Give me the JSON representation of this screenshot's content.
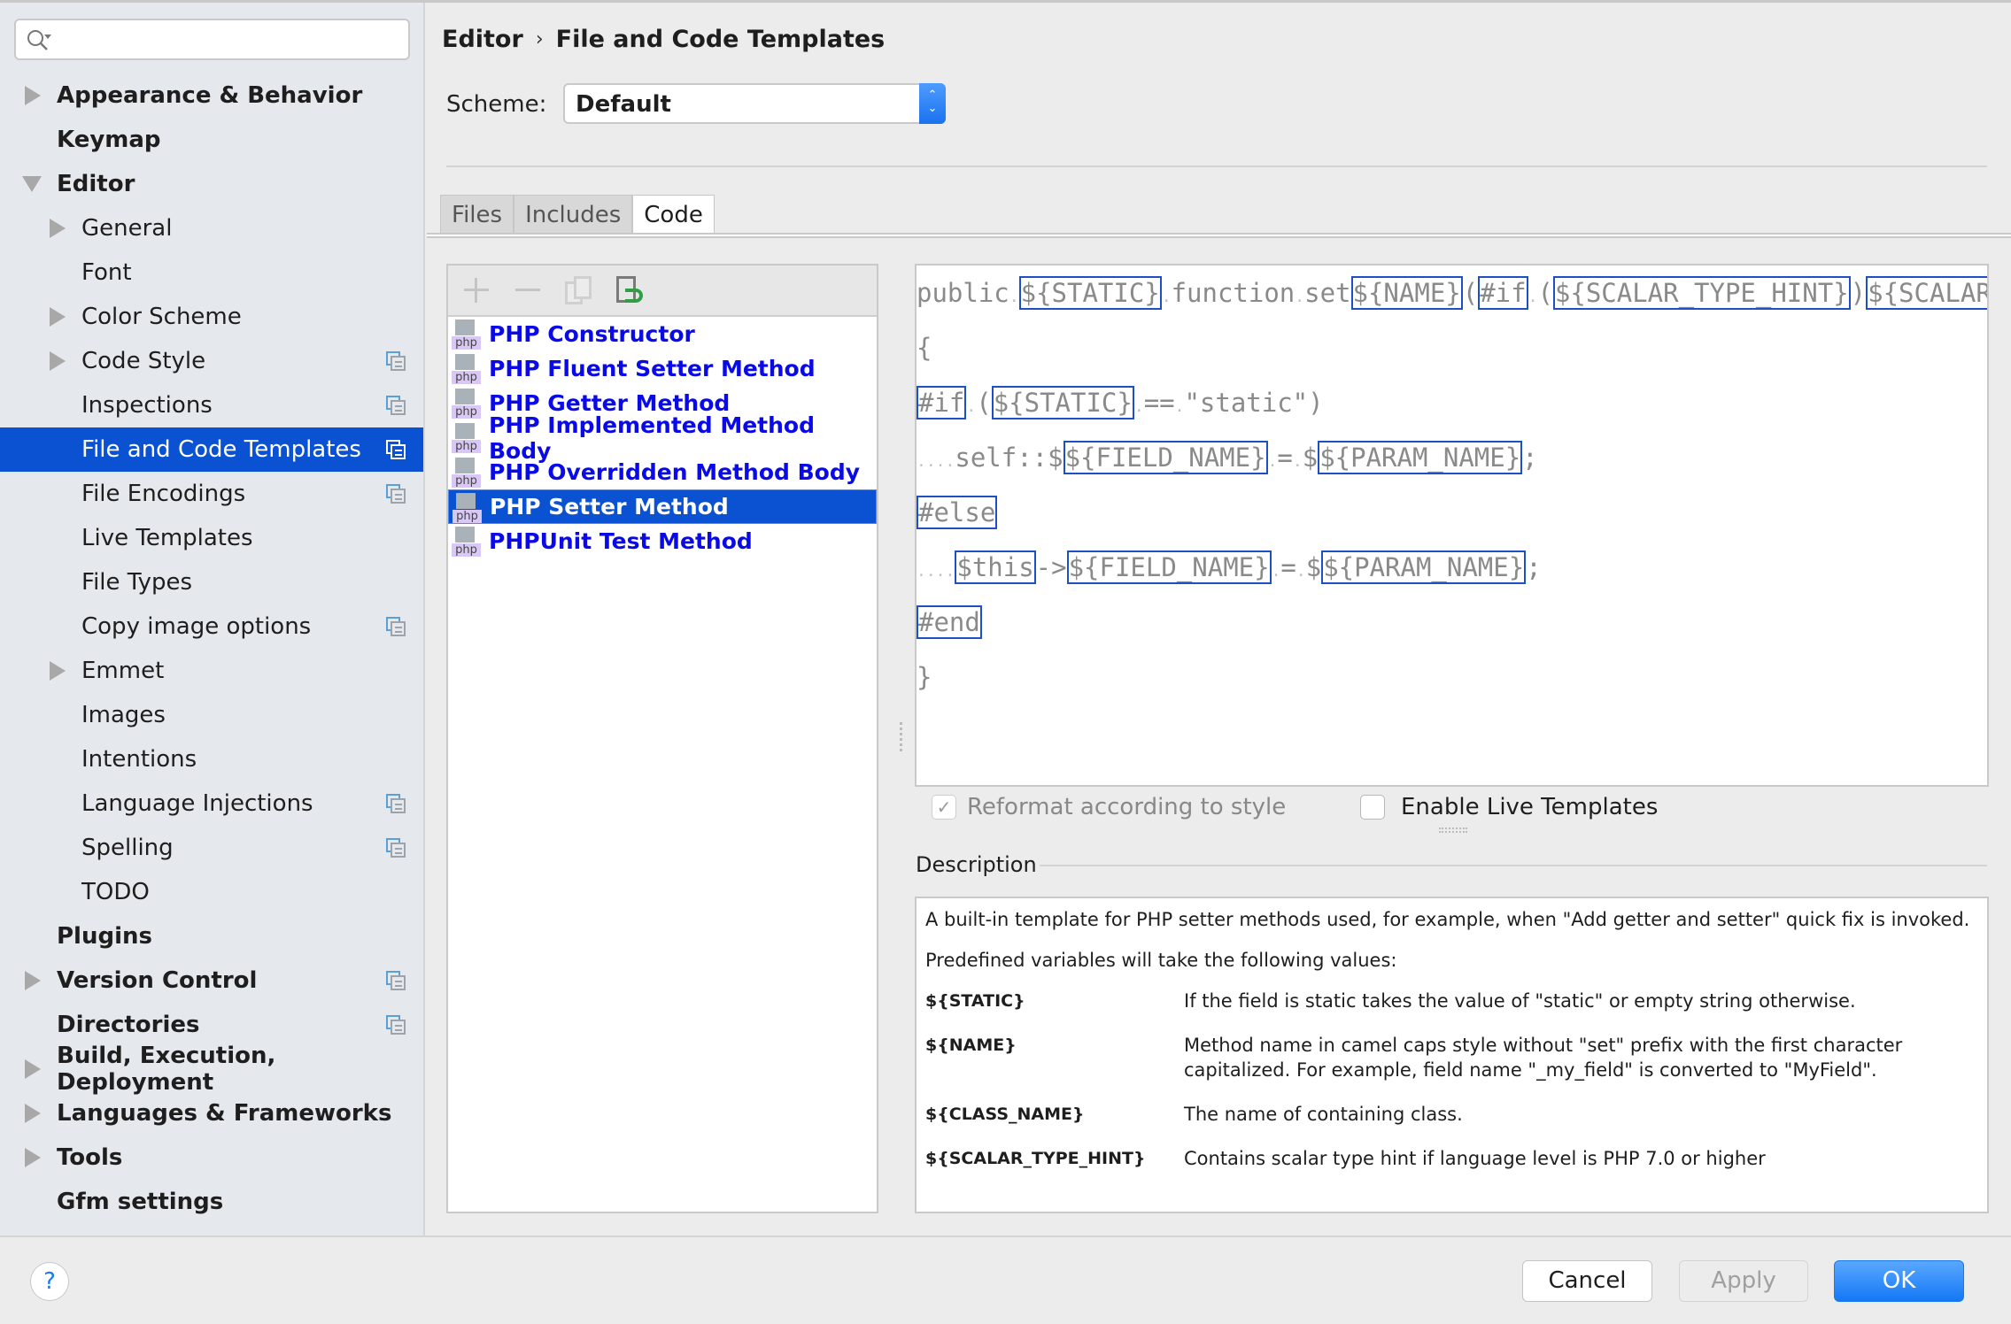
{
  "search": {
    "placeholder": "",
    "value": ""
  },
  "sidebar": {
    "items": [
      {
        "label": "Appearance & Behavior",
        "level": 0,
        "arrow": "right",
        "project": false
      },
      {
        "label": "Keymap",
        "level": 0,
        "arrow": "none",
        "project": false
      },
      {
        "label": "Editor",
        "level": 0,
        "arrow": "down",
        "project": false
      },
      {
        "label": "General",
        "level": 1,
        "arrow": "right",
        "project": false
      },
      {
        "label": "Font",
        "level": 1,
        "arrow": "none",
        "project": false
      },
      {
        "label": "Color Scheme",
        "level": 1,
        "arrow": "right",
        "project": false
      },
      {
        "label": "Code Style",
        "level": 1,
        "arrow": "right",
        "project": true
      },
      {
        "label": "Inspections",
        "level": 1,
        "arrow": "none",
        "project": true
      },
      {
        "label": "File and Code Templates",
        "level": 1,
        "arrow": "none",
        "project": true,
        "selected": true
      },
      {
        "label": "File Encodings",
        "level": 1,
        "arrow": "none",
        "project": true
      },
      {
        "label": "Live Templates",
        "level": 1,
        "arrow": "none",
        "project": false
      },
      {
        "label": "File Types",
        "level": 1,
        "arrow": "none",
        "project": false
      },
      {
        "label": "Copy image options",
        "level": 1,
        "arrow": "none",
        "project": true
      },
      {
        "label": "Emmet",
        "level": 1,
        "arrow": "right",
        "project": false
      },
      {
        "label": "Images",
        "level": 1,
        "arrow": "none",
        "project": false
      },
      {
        "label": "Intentions",
        "level": 1,
        "arrow": "none",
        "project": false
      },
      {
        "label": "Language Injections",
        "level": 1,
        "arrow": "none",
        "project": true
      },
      {
        "label": "Spelling",
        "level": 1,
        "arrow": "none",
        "project": true
      },
      {
        "label": "TODO",
        "level": 1,
        "arrow": "none",
        "project": false
      },
      {
        "label": "Plugins",
        "level": 0,
        "arrow": "none",
        "project": false
      },
      {
        "label": "Version Control",
        "level": 0,
        "arrow": "right",
        "project": true
      },
      {
        "label": "Directories",
        "level": 0,
        "arrow": "none",
        "project": true
      },
      {
        "label": "Build, Execution, Deployment",
        "level": 0,
        "arrow": "right",
        "project": false
      },
      {
        "label": "Languages & Frameworks",
        "level": 0,
        "arrow": "right",
        "project": false
      },
      {
        "label": "Tools",
        "level": 0,
        "arrow": "right",
        "project": false
      },
      {
        "label": "Gfm settings",
        "level": 0,
        "arrow": "none",
        "project": false
      }
    ]
  },
  "header": {
    "breadcrumb": [
      "Editor",
      "File and Code Templates"
    ],
    "breadcrumb_separator": "›",
    "scheme_label": "Scheme:",
    "scheme_value": "Default"
  },
  "tabs": [
    {
      "label": "Files",
      "active": false
    },
    {
      "label": "Includes",
      "active": false
    },
    {
      "label": "Code",
      "active": true
    }
  ],
  "templates": {
    "icon_label": "php",
    "items": [
      {
        "label": "PHP Constructor"
      },
      {
        "label": "PHP Fluent Setter Method"
      },
      {
        "label": "PHP Getter Method"
      },
      {
        "label": "PHP Implemented Method Body"
      },
      {
        "label": "PHP Overridden Method Body"
      },
      {
        "label": "PHP Setter Method",
        "selected": true
      },
      {
        "label": "PHPUnit Test Method"
      }
    ]
  },
  "code": {
    "lines": [
      [
        [
          "t",
          "public"
        ],
        [
          "d",
          "."
        ],
        [
          "v",
          "${STATIC}"
        ],
        [
          "d",
          "."
        ],
        [
          "t",
          "function"
        ],
        [
          "d",
          "."
        ],
        [
          "t",
          "set"
        ],
        [
          "v",
          "${NAME}"
        ],
        [
          "t",
          "("
        ],
        [
          "v",
          "#if"
        ],
        [
          "d",
          "."
        ],
        [
          "t",
          "("
        ],
        [
          "v",
          "${SCALAR_TYPE_HINT}"
        ],
        [
          "t",
          ")"
        ],
        [
          "v",
          "${SCALAR_TYPE_"
        ]
      ],
      [
        [
          "t",
          "{"
        ]
      ],
      [
        [
          "v",
          "#if"
        ],
        [
          "d",
          "."
        ],
        [
          "t",
          "("
        ],
        [
          "v",
          "${STATIC}"
        ],
        [
          "d",
          "."
        ],
        [
          "t",
          "=="
        ],
        [
          "d",
          "."
        ],
        [
          "t",
          "\"static\")"
        ]
      ],
      [
        [
          "d",
          "...."
        ],
        [
          "t",
          "self::$"
        ],
        [
          "v",
          "${FIELD_NAME}"
        ],
        [
          "d",
          "."
        ],
        [
          "t",
          "="
        ],
        [
          "d",
          "."
        ],
        [
          "t",
          "$"
        ],
        [
          "v",
          "${PARAM_NAME}"
        ],
        [
          "t",
          ";"
        ]
      ],
      [
        [
          "v",
          "#else"
        ]
      ],
      [
        [
          "d",
          "...."
        ],
        [
          "v",
          "$this"
        ],
        [
          "t",
          "->"
        ],
        [
          "v",
          "${FIELD_NAME}"
        ],
        [
          "d",
          "."
        ],
        [
          "t",
          "="
        ],
        [
          "d",
          "."
        ],
        [
          "t",
          "$"
        ],
        [
          "v",
          "${PARAM_NAME}"
        ],
        [
          "t",
          ";"
        ]
      ],
      [
        [
          "v",
          "#end"
        ]
      ],
      [
        [
          "t",
          "}"
        ]
      ]
    ]
  },
  "options": {
    "reformat_label": "Reformat according to style",
    "reformat_checked": true,
    "reformat_enabled": false,
    "live_templates_label": "Enable Live Templates",
    "live_templates_checked": false
  },
  "description": {
    "title": "Description",
    "intro": "A built-in template for PHP setter methods used, for example, when \"Add getter and setter\" quick fix is invoked.",
    "predefined": "Predefined variables will take the following values:",
    "variables": [
      {
        "name": "${STATIC}",
        "text": "If the field is static takes the value of \"static\" or empty string otherwise."
      },
      {
        "name": "${NAME}",
        "text": "Method name in camel caps style without \"set\" prefix with the first character capitalized. For example, field name \"_my_field\" is converted to \"MyField\"."
      },
      {
        "name": "${CLASS_NAME}",
        "text": "The name of containing class."
      },
      {
        "name": "${SCALAR_TYPE_HINT}",
        "text": "Contains scalar type hint if language level is PHP 7.0 or higher"
      }
    ]
  },
  "footer": {
    "help_label": "?",
    "cancel_label": "Cancel",
    "apply_label": "Apply",
    "ok_label": "OK"
  },
  "colors": {
    "selection": "#0a52d2",
    "template_link": "#0a0ae6",
    "variable_border": "#1f4fc4",
    "ok_button": "#1478f5"
  }
}
